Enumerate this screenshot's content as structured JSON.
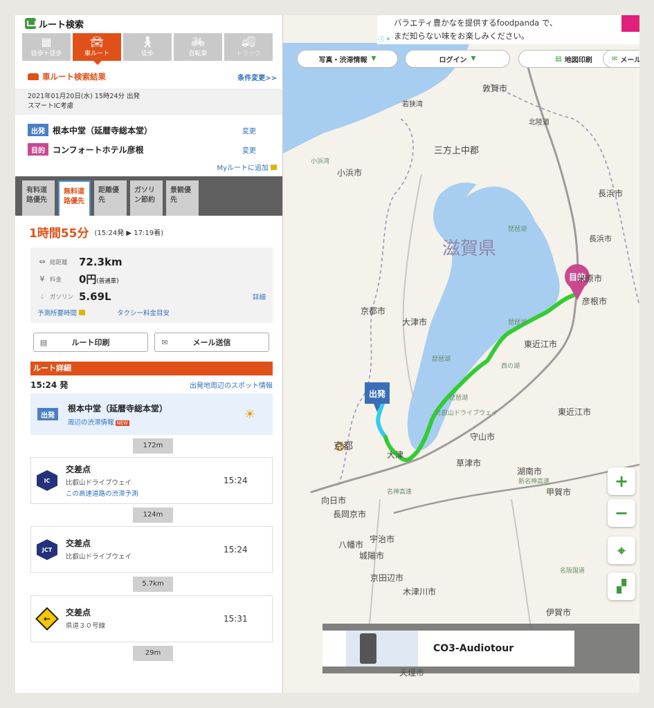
{
  "panel": {
    "title": "ルート検索",
    "modes": [
      {
        "label": "徒歩＋徒歩",
        "icon": "building-icon"
      },
      {
        "label": "車ルート",
        "icon": "car-icon"
      },
      {
        "label": "徒歩",
        "icon": "walk-icon"
      },
      {
        "label": "自転車",
        "icon": "bicycle-icon"
      },
      {
        "label": "トラック",
        "icon": "truck-icon"
      }
    ],
    "result_title": "車ルート検索結果",
    "change_conditions": "条件変更>>",
    "datetime": "2021年01月20日(水) 15時24分 出発",
    "smart_ic": "スマートIC考慮",
    "origin_tag": "出発",
    "origin": "根本中堂（延暦寺総本堂）",
    "dest_tag": "目的",
    "destination": "コンフォートホテル彦根",
    "change": "変更",
    "add_myroute": "Myルートに追加",
    "priorities": [
      "有料道路優先",
      "無料道路優先",
      "距離優先",
      "ガソリン節約",
      "景観優先"
    ],
    "duration": "1時間55分",
    "duration_sub": "(15:24発 ▶ 17:19着)",
    "stats": {
      "distance_label": "総距離",
      "distance": "72.3km",
      "fee_label": "料金",
      "fee": "0円",
      "fee_note": "(普通車)",
      "gas_label": "ガソリン",
      "gas": "5.69L",
      "detail": "詳細",
      "link1": "予測所要時間",
      "link2": "タクシー料金目安"
    },
    "print_btn": "ルート印刷",
    "mail_btn": "メール送信",
    "route_detail": "ルート詳細",
    "dep_time": "15:24 発",
    "spot_link": "出発地周辺のスポット情報",
    "start": {
      "name": "根本中堂（延暦寺総本堂）",
      "link": "周辺の渋滞情報",
      "new": "NEW"
    },
    "steps": [
      {
        "dist": "172m",
        "icon": "IC",
        "title": "交差点",
        "road": "比叡山ドライブウェイ",
        "link": "この高速道路の渋滞予測",
        "time": "15:24"
      },
      {
        "dist": "124m",
        "icon": "JCT",
        "title": "交差点",
        "road": "比叡山ドライブウェイ",
        "link": "",
        "time": "15:24"
      },
      {
        "dist": "5.7km",
        "icon": "←",
        "title": "交差点",
        "road": "県道３０号線",
        "link": "",
        "time": "15:31"
      }
    ],
    "last_dist": "29m"
  },
  "map": {
    "ad_top_line1": "バラエティ豊かなを提供するfoodpanda で、",
    "ad_top_line2": "まだ知らない味をお楽しみください。",
    "ad_info": "ⓘ ✕",
    "buttons": [
      "写真・渋滞情報",
      "ログイン",
      "地図印刷",
      "メール"
    ],
    "pref": "滋賀県",
    "labels": [
      "敦賀市",
      "若狭湾",
      "三方上中郡",
      "小浜市",
      "北陸道",
      "長浜市",
      "長浜市",
      "米原市",
      "彦根市",
      "琵琶湖",
      "琵琶湖",
      "琵琶湖",
      "琵琶湖",
      "京都市",
      "大津市",
      "東近江市",
      "東近江市",
      "西の湖",
      "守山市",
      "草津市",
      "湖南市",
      "甲賀市",
      "京都",
      "大津",
      "向日市",
      "長岡京市",
      "宇治市",
      "城陽市",
      "京田辺市",
      "木津川市",
      "伊賀市",
      "天理市",
      "名神高速",
      "新名神高速",
      "比叡山ドライブウェイ",
      "名阪国道",
      "小浜湾",
      "八幡市"
    ],
    "origin_pin": "出発",
    "dest_pin": "目的",
    "ad_bottom_title": "CO3-Audiotour",
    "colors": {
      "route": "#33cc33",
      "route_start": "#33ccee",
      "lake": "#a7cdf0",
      "accent": "#e0511a",
      "green": "#3b9a3b"
    }
  }
}
